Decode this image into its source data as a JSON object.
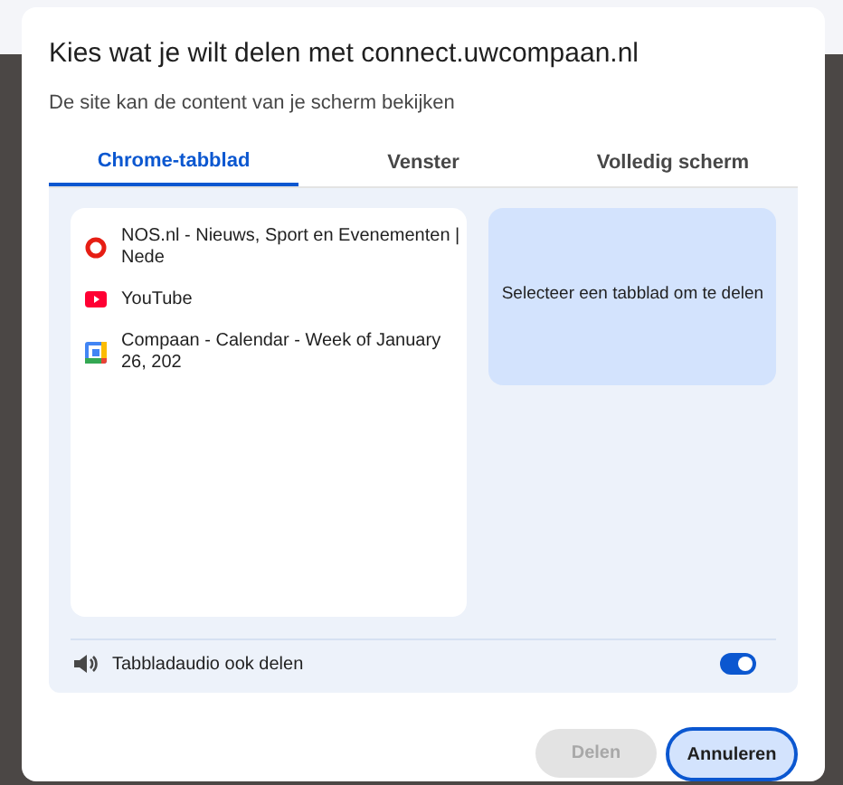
{
  "dialog": {
    "title": "Kies wat je wilt delen met connect.uwcompaan.nl",
    "subtitle": "De site kan de content van je scherm bekijken"
  },
  "tabs": [
    {
      "label": "Chrome-tabblad",
      "selected": true
    },
    {
      "label": "Venster",
      "selected": false
    },
    {
      "label": "Volledig scherm",
      "selected": false
    }
  ],
  "tab_list": [
    {
      "kind": "nos",
      "title": "NOS.nl - Nieuws, Sport en Evenementen | Nede",
      "selected": false
    },
    {
      "kind": "youtube",
      "title": "YouTube",
      "selected": false
    },
    {
      "kind": "calendar",
      "title": "Compaan - Calendar - Week of January 26, 202",
      "selected": false
    }
  ],
  "preview": {
    "message": "Selecteer een tabblad om te delen"
  },
  "audio": {
    "label": "Tabbladaudio ook delen",
    "on": true
  },
  "buttons": [
    {
      "label": "Delen",
      "disabled": true
    },
    {
      "label": "Annuleren",
      "disabled": false
    }
  ]
}
